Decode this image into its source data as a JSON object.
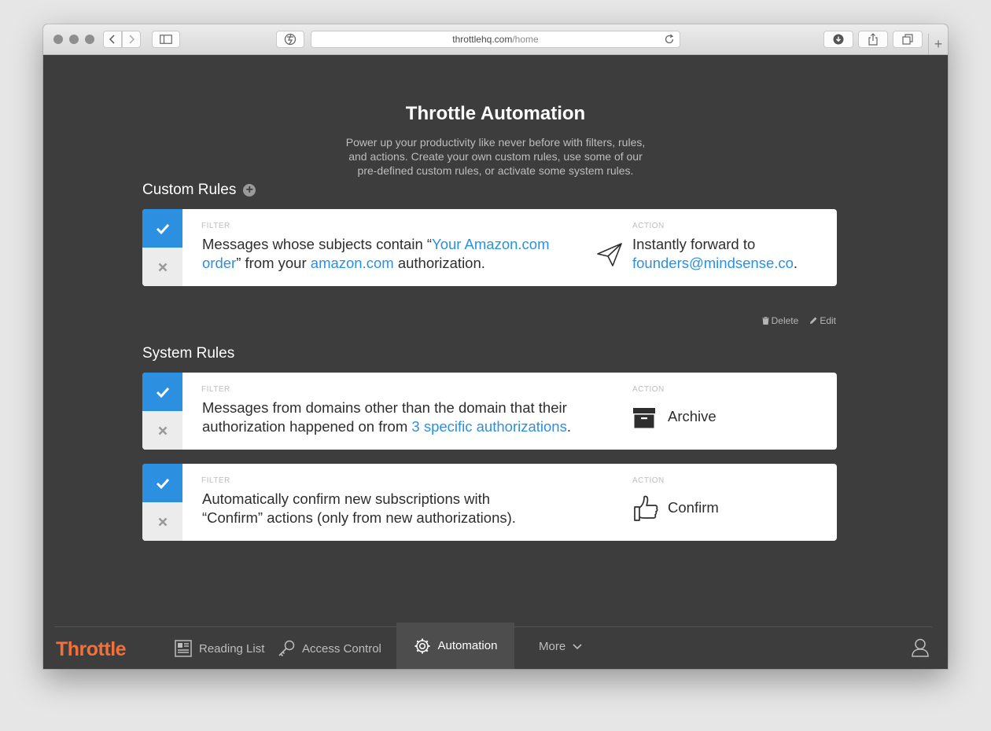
{
  "browser": {
    "url_host": "throttlehq.com",
    "url_path": "/home",
    "new_tab_label": "+"
  },
  "page": {
    "title": "Throttle Automation",
    "intro": "Power up your productivity like never before with filters, rules, and actions. Create your own custom rules, use some of our pre-defined custom rules, or activate some system rules."
  },
  "custom_rules": {
    "heading": "Custom Rules",
    "add_icon": "+",
    "rules": [
      {
        "filter_label": "FILTER",
        "filter_pre": "Messages whose subjects contain “",
        "filter_link1": "Your Amazon.com order",
        "filter_mid": "” from your ",
        "filter_link2": "amazon.com",
        "filter_post": " authorization.",
        "action_label": "ACTION",
        "action_icon": "paper-plane-icon",
        "action_text": "Instantly forward to",
        "action_link": "founders@mindsense.co",
        "action_post": "."
      }
    ],
    "delete_label": "Delete",
    "edit_label": "Edit"
  },
  "system_rules": {
    "heading": "System Rules",
    "rules": [
      {
        "filter_label": "FILTER",
        "filter_pre": "Messages from domains other than the domain that their authorization happened on from ",
        "filter_link": "3 specific authorizations",
        "filter_post": ".",
        "action_label": "ACTION",
        "action_icon": "archive-box-icon",
        "action_text": "Archive"
      },
      {
        "filter_label": "FILTER",
        "filter_text": "Automatically confirm new subscriptions with “Confirm” actions (only from new authorizations).",
        "action_label": "ACTION",
        "action_icon": "thumbs-up-icon",
        "action_text": "Confirm"
      }
    ]
  },
  "bottom_nav": {
    "logo": "Throttle",
    "items": [
      {
        "label": "Reading List",
        "icon": "newspaper-icon"
      },
      {
        "label": "Access Control",
        "icon": "key-icon"
      },
      {
        "label": "Automation",
        "icon": "gear-icon",
        "active": true
      },
      {
        "label": "More",
        "icon": "chevron-down-icon"
      }
    ],
    "user_icon": "user-icon"
  },
  "colors": {
    "background": "#3d3d3d",
    "accent": "#2d8fe0",
    "brand": "#f2703a"
  }
}
